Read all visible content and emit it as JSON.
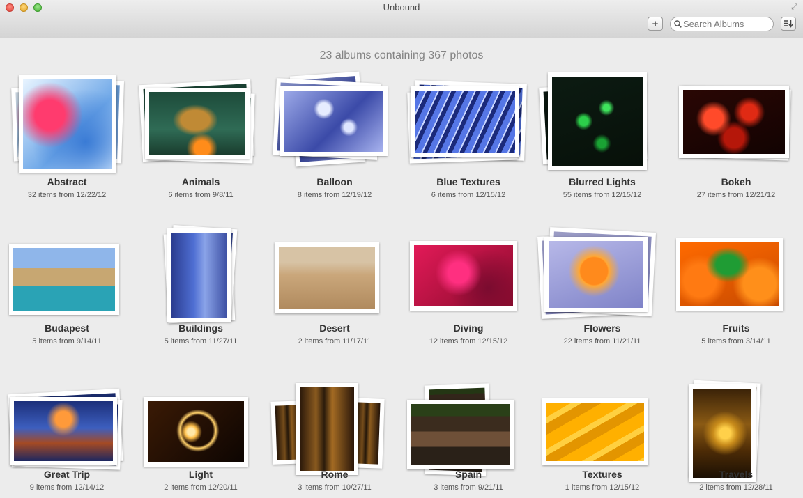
{
  "window": {
    "title": "Unbound"
  },
  "toolbar": {
    "add_label": "+",
    "search_placeholder": "Search Albums",
    "sort_label": "⇩"
  },
  "summary": "23 albums containing 367 photos",
  "albums": [
    {
      "name": "Abstract",
      "meta": "32 items from 12/22/12",
      "icon": "abstract-drops-image"
    },
    {
      "name": "Animals",
      "meta": "6 items from 9/8/11",
      "icon": "butterfly-image"
    },
    {
      "name": "Balloon",
      "meta": "8 items from 12/19/12",
      "icon": "bubbles-image"
    },
    {
      "name": "Blue Textures",
      "meta": "6 items from 12/15/12",
      "icon": "blue-lines-image"
    },
    {
      "name": "Blurred Lights",
      "meta": "55 items from 12/15/12",
      "icon": "green-lights-image"
    },
    {
      "name": "Bokeh",
      "meta": "27 items from 12/21/12",
      "icon": "red-bokeh-image"
    },
    {
      "name": "Budapest",
      "meta": "5 items from 9/14/11",
      "icon": "budapest-bath-image"
    },
    {
      "name": "Buildings",
      "meta": "5 items from 11/27/11",
      "icon": "blue-street-image"
    },
    {
      "name": "Desert",
      "meta": "2 items from 11/17/11",
      "icon": "desert-walker-image"
    },
    {
      "name": "Diving",
      "meta": "12 items from 12/15/12",
      "icon": "pink-coral-image"
    },
    {
      "name": "Flowers",
      "meta": "22 items from 11/21/11",
      "icon": "orange-flower-image"
    },
    {
      "name": "Fruits",
      "meta": "5 items from 3/14/11",
      "icon": "peppers-image"
    },
    {
      "name": "Great Trip",
      "meta": "9 items from 12/14/12",
      "icon": "escalator-image"
    },
    {
      "name": "Light",
      "meta": "2 items from 12/20/11",
      "icon": "fire-circles-image"
    },
    {
      "name": "Rome",
      "meta": "3 items from 10/27/11",
      "icon": "cistern-image"
    },
    {
      "name": "Spain",
      "meta": "3 items from 9/21/11",
      "icon": "plaza-image"
    },
    {
      "name": "Textures",
      "meta": "1 items from 12/15/12",
      "icon": "yellow-texture-image"
    },
    {
      "name": "Travels",
      "meta": "2 items from 12/28/11",
      "icon": "golden-temple-image"
    }
  ]
}
